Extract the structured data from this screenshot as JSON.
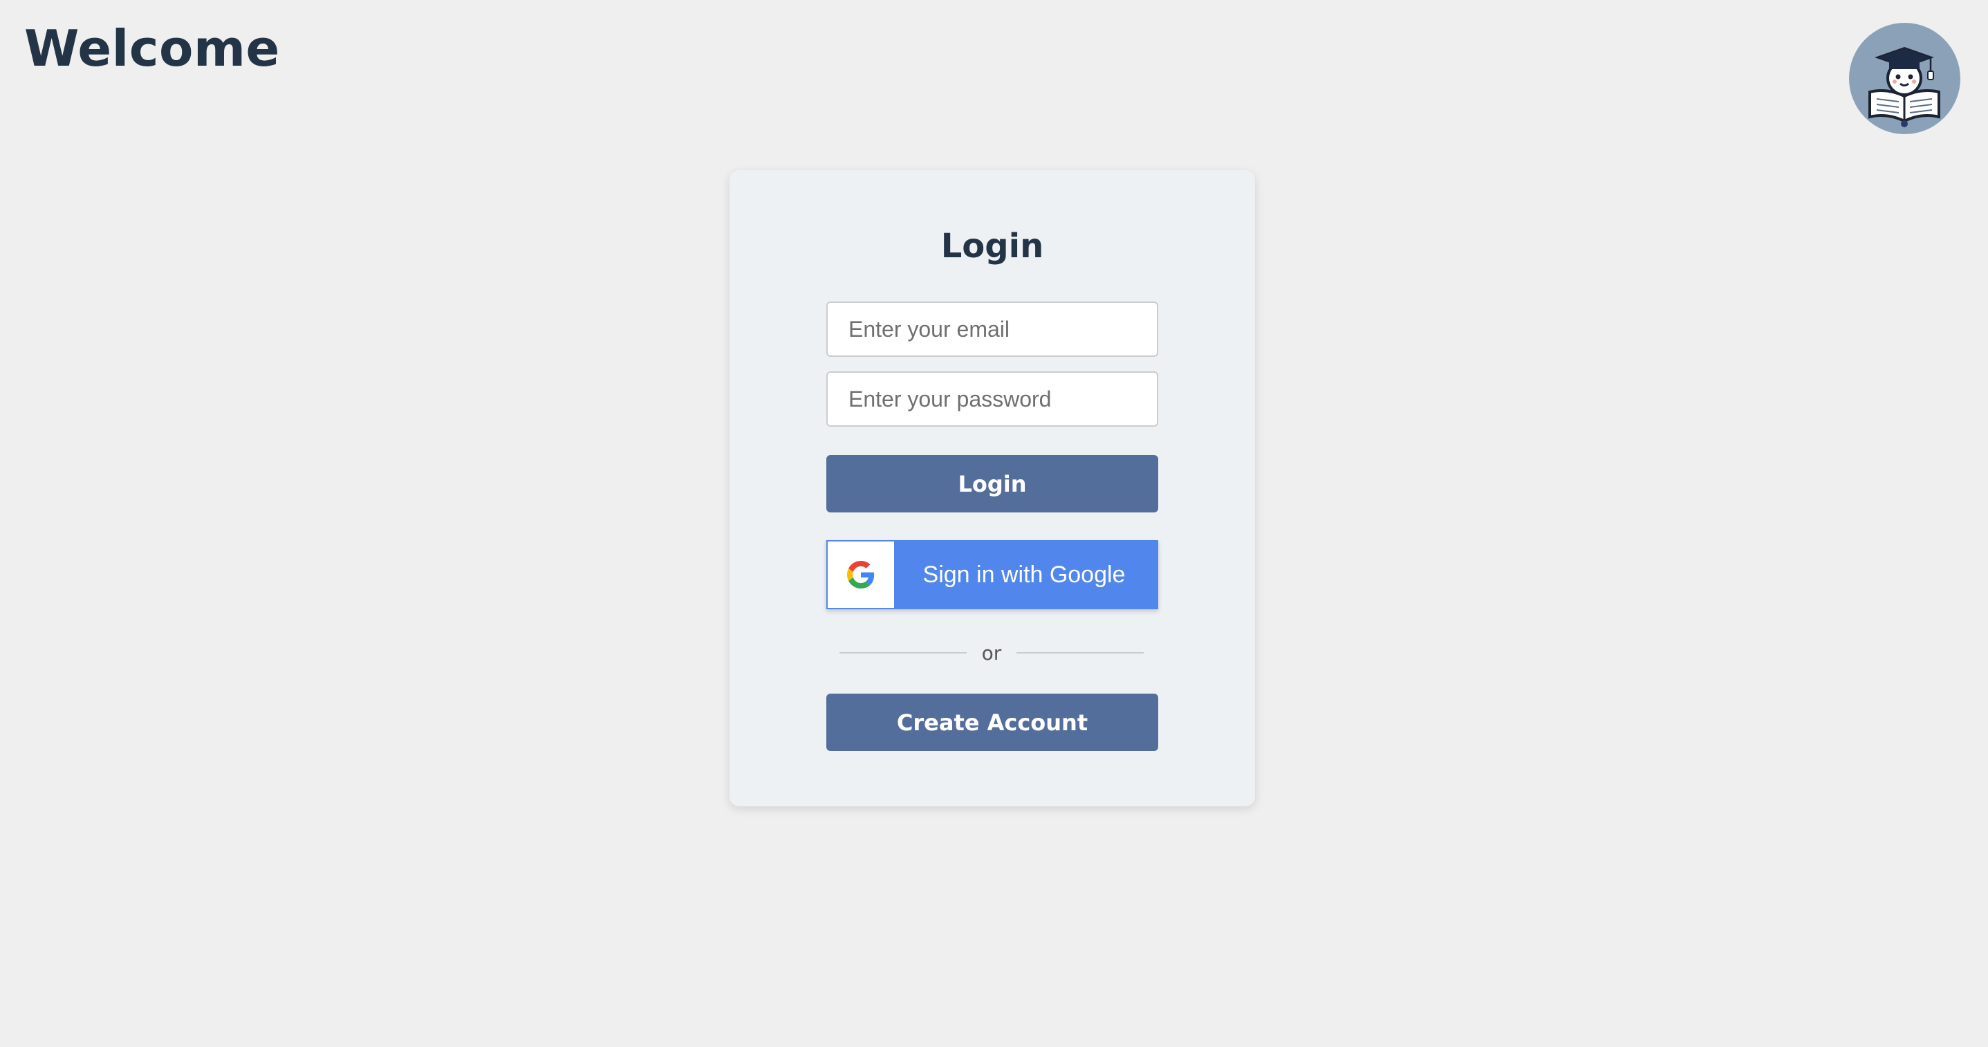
{
  "header": {
    "title": "Welcome"
  },
  "avatar": {
    "icon": "graduate-reading-book-icon"
  },
  "login_card": {
    "title": "Login",
    "email_placeholder": "Enter your email",
    "password_placeholder": "Enter your password",
    "login_label": "Login",
    "google_label": "Sign in with Google",
    "divider_text": "or",
    "create_account_label": "Create Account"
  },
  "colors": {
    "background": "#efefef",
    "card": "#eef1f4",
    "primary_button": "#546e9c",
    "google_button": "#5187ec",
    "heading": "#243447"
  }
}
